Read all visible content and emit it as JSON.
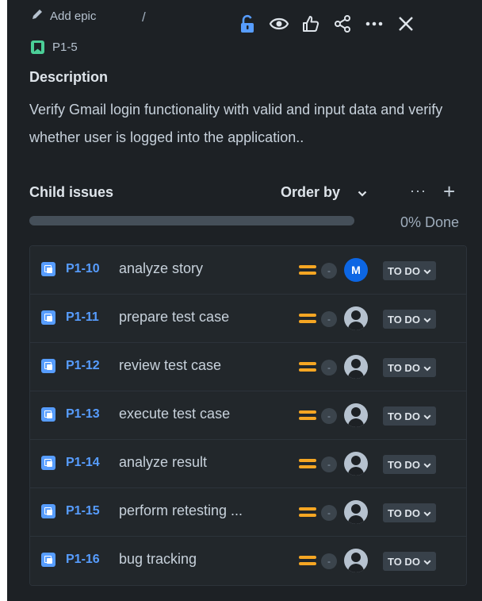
{
  "header": {
    "add_epic_label": "Add epic",
    "separator": "/",
    "issue_key": "P1-5"
  },
  "actions": [
    "unlock-icon",
    "watch-icon",
    "like-icon",
    "share-icon",
    "more-icon",
    "close-icon"
  ],
  "description": {
    "title": "Description",
    "text": "Verify Gmail login functionality with valid and input data and verify whether user is logged into the application.."
  },
  "child_issues": {
    "title": "Child issues",
    "order_by_label": "Order by",
    "more_label": "···",
    "add_label": "+",
    "progress_percent": 0,
    "progress_label": "0% Done",
    "items": [
      {
        "key": "P1-10",
        "summary": "analyze story",
        "estimate": "-",
        "assignee": "M",
        "status": "TO DO"
      },
      {
        "key": "P1-11",
        "summary": "prepare test case",
        "estimate": "-",
        "assignee": "",
        "status": "TO DO"
      },
      {
        "key": "P1-12",
        "summary": "review test case",
        "estimate": "-",
        "assignee": "",
        "status": "TO DO"
      },
      {
        "key": "P1-13",
        "summary": "execute test case",
        "estimate": "-",
        "assignee": "",
        "status": "TO DO"
      },
      {
        "key": "P1-14",
        "summary": "analyze result",
        "estimate": "-",
        "assignee": "",
        "status": "TO DO"
      },
      {
        "key": "P1-15",
        "summary": "perform retesting ...",
        "estimate": "-",
        "assignee": "",
        "status": "TO DO"
      },
      {
        "key": "P1-16",
        "summary": "bug tracking",
        "estimate": "-",
        "assignee": "",
        "status": "TO DO"
      }
    ]
  },
  "colors": {
    "background": "#1d2125",
    "link": "#579dff",
    "priority": "#f5a623",
    "unlock": "#579dff",
    "avatar_m": "#0c66e4",
    "progress_done": "#4bce97"
  }
}
